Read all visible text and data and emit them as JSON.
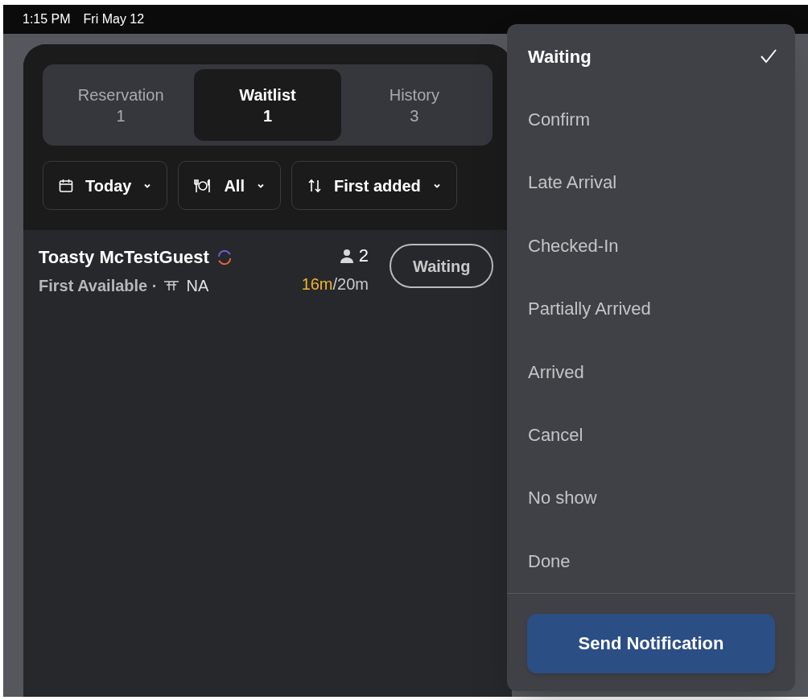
{
  "status_bar": {
    "time": "1:15 PM",
    "date": "Fri May 12"
  },
  "tabs": [
    {
      "label": "Reservation",
      "count": "1",
      "selected": false
    },
    {
      "label": "Waitlist",
      "count": "1",
      "selected": true
    },
    {
      "label": "History",
      "count": "3",
      "selected": false
    }
  ],
  "filters": [
    {
      "kind": "date",
      "label": "Today"
    },
    {
      "kind": "service",
      "label": "All"
    },
    {
      "kind": "sort",
      "label": "First added"
    }
  ],
  "entries": [
    {
      "name": "Toasty McTestGuest",
      "seating": "First Available ·",
      "table": "NA",
      "party_size": "2",
      "wait_elapsed": "16m",
      "wait_quoted": "/20m",
      "status": "Waiting"
    }
  ],
  "status_menu": {
    "items": [
      {
        "label": "Waiting",
        "selected": true
      },
      {
        "label": "Confirm",
        "selected": false
      },
      {
        "label": "Late Arrival",
        "selected": false
      },
      {
        "label": "Checked-In",
        "selected": false
      },
      {
        "label": "Partially Arrived",
        "selected": false
      },
      {
        "label": "Arrived",
        "selected": false
      },
      {
        "label": "Cancel",
        "selected": false
      },
      {
        "label": "No show",
        "selected": false
      },
      {
        "label": "Done",
        "selected": false
      }
    ],
    "action": "Send Notification"
  }
}
